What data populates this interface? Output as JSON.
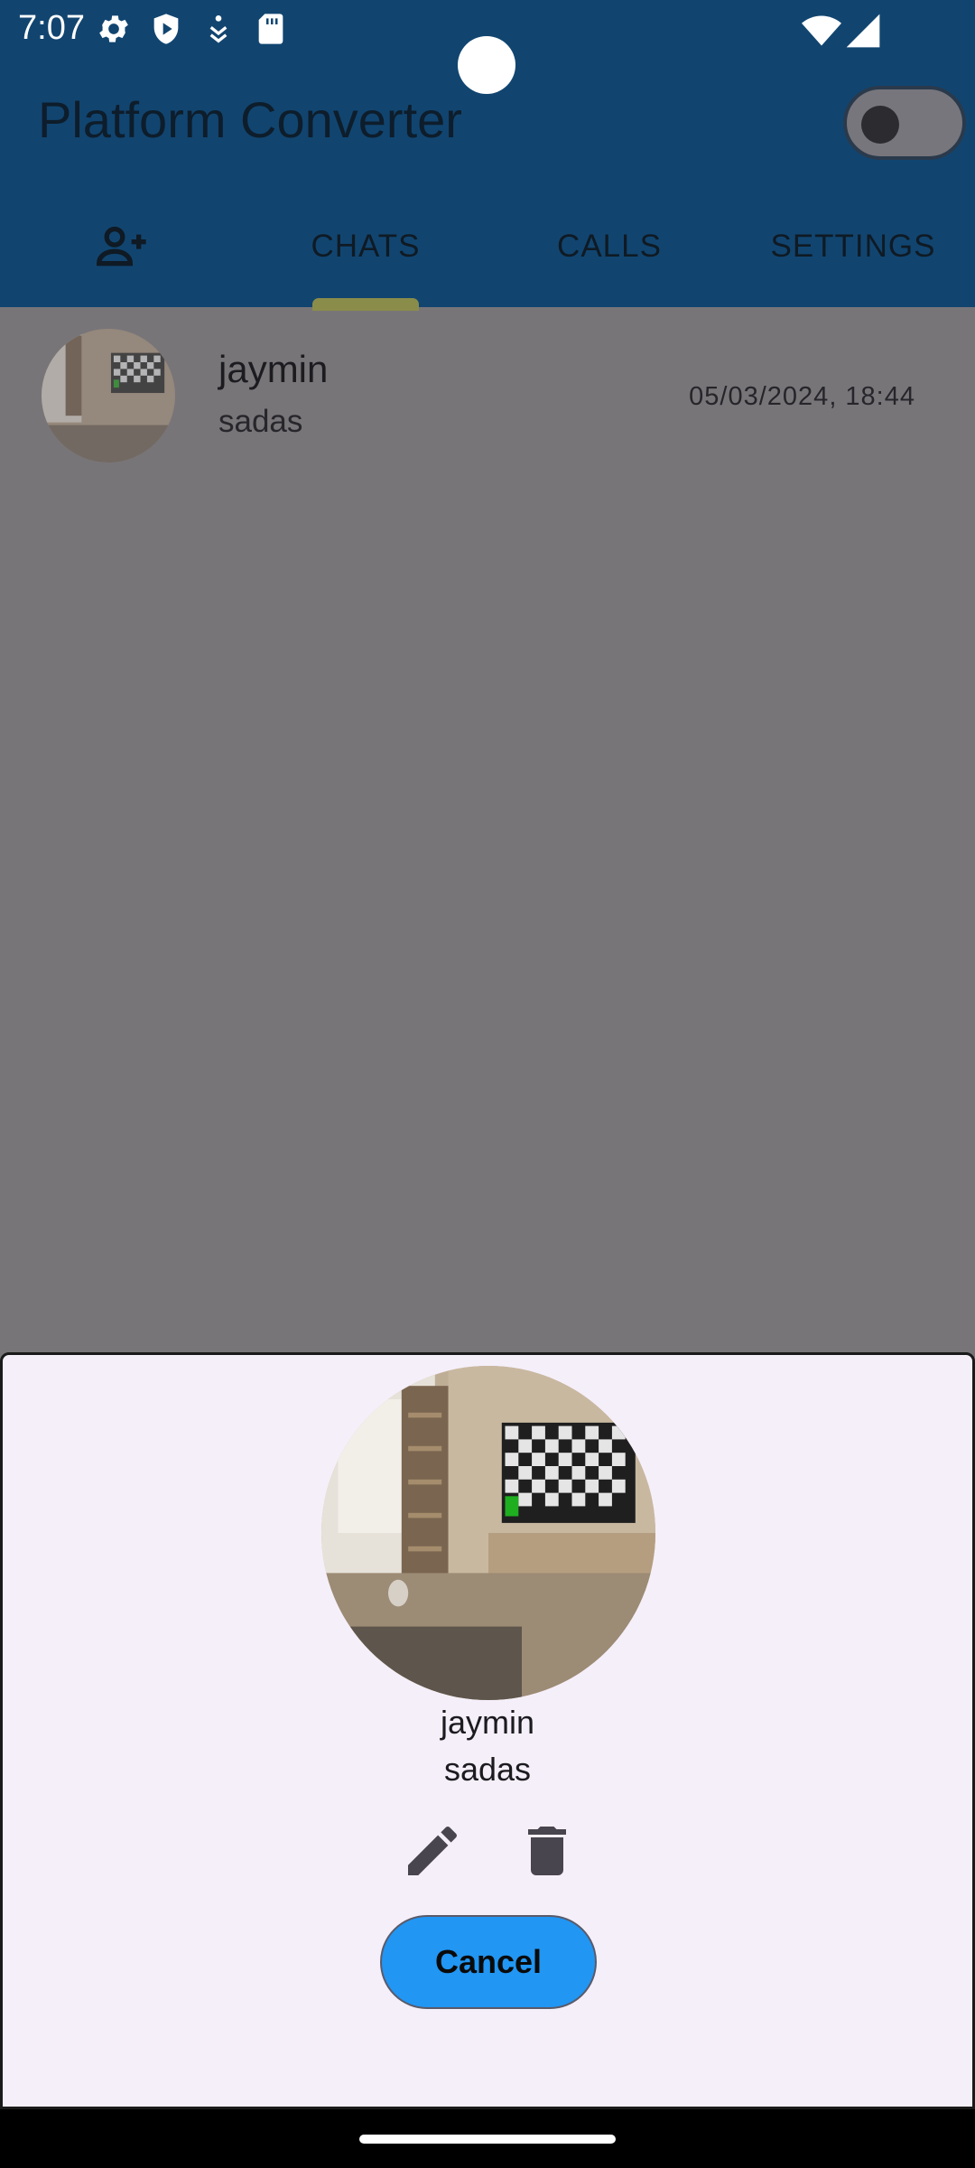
{
  "status_bar": {
    "time": "7:07",
    "icons": [
      "gear-icon",
      "play-protect-icon",
      "accessibility-icon",
      "sd-card-icon",
      "wifi-icon",
      "signal-icon"
    ]
  },
  "app_bar": {
    "title": "Platform Converter",
    "theme_toggle": {
      "on": false
    }
  },
  "tabs": [
    {
      "label": "",
      "icon": "add-person-icon"
    },
    {
      "label": "CHATS",
      "selected": true
    },
    {
      "label": "CALLS"
    },
    {
      "label": "SETTINGS"
    }
  ],
  "chat_list": [
    {
      "name": "jaymin",
      "message": "sadas",
      "timestamp": "05/03/2024, 18:44"
    }
  ],
  "sheet": {
    "name": "jaymin",
    "message": "sadas",
    "edit_icon": "edit-icon",
    "delete_icon": "delete-icon",
    "cancel_label": "Cancel"
  },
  "colors": {
    "app_bar": "#114570",
    "scrim": "#787579",
    "sheet_bg": "#f5eff9",
    "cancel_button": "#2196f3",
    "tab_indicator": "#8a8c4a"
  }
}
